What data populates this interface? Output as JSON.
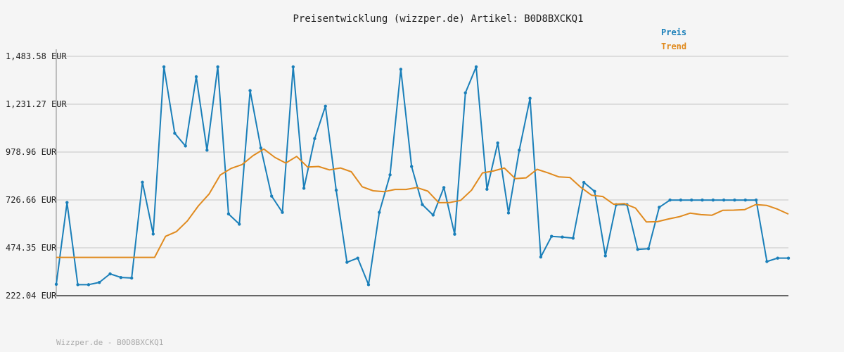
{
  "chart_data": {
    "type": "line",
    "title": "Preisentwicklung (wizzper.de) Artikel: B0D8BXCKQ1",
    "legend": [
      "Preis",
      "Trend"
    ],
    "legend_position": "top-right",
    "y_ticks": [
      "222.04 EUR",
      "474.35 EUR",
      "726.66 EUR",
      "978.96 EUR",
      "1,231.27 EUR",
      "1,483.58 EUR"
    ],
    "y_tick_values": [
      222.04,
      474.35,
      726.66,
      978.96,
      1231.27,
      1483.58
    ],
    "ylim": [
      222.04,
      1483.58
    ],
    "grid": true,
    "series": [
      {
        "name": "Preis",
        "color": "#1a7fb9",
        "values": [
          282,
          713,
          280,
          280,
          292,
          337,
          318,
          315,
          820,
          547,
          1428,
          1078,
          1011,
          1376,
          989,
          1428,
          653,
          599,
          1303,
          1000,
          747,
          661,
          1428,
          788,
          1050,
          1221,
          778,
          398,
          420,
          280,
          661,
          859,
          1415,
          903,
          702,
          647,
          792,
          546,
          1291,
          1428,
          783,
          1027,
          658,
          989,
          1262,
          426,
          535,
          531,
          525,
          819,
          772,
          432,
          702,
          702,
          466,
          470,
          688,
          726,
          726,
          726,
          726,
          726,
          726,
          726,
          726,
          726,
          402,
          420,
          420
        ]
      },
      {
        "name": "Trend",
        "color": "#e08a1e",
        "values": [
          424,
          424,
          424,
          424,
          424,
          424,
          424,
          424,
          424,
          424,
          535,
          560,
          616,
          695,
          759,
          858,
          893,
          913,
          960,
          995,
          951,
          921,
          956,
          900,
          903,
          885,
          895,
          875,
          796,
          775,
          770,
          782,
          782,
          792,
          773,
          712,
          713,
          724,
          778,
          869,
          879,
          895,
          839,
          843,
          888,
          869,
          848,
          845,
          793,
          751,
          745,
          704,
          707,
          684,
          611,
          612,
          626,
          638,
          657,
          649,
          646,
          672,
          673,
          676,
          702,
          698,
          678,
          652
        ]
      }
    ],
    "footer": "Wizzper.de - B0D8BXCKQ1"
  }
}
